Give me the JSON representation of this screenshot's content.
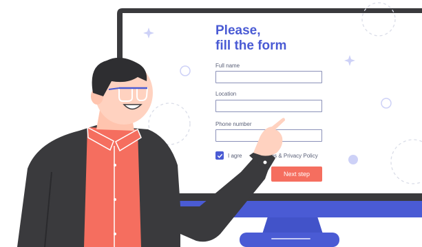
{
  "form": {
    "title_line1": "Please,",
    "title_line2": "fill the form",
    "fields": [
      {
        "label": "Full name",
        "value": ""
      },
      {
        "label": "Location",
        "value": ""
      },
      {
        "label": "Phone number",
        "value": ""
      }
    ],
    "agree_visible_prefix": "I agre",
    "agree_visible_suffix": "ms & Privacy Policy",
    "agree_checked": true,
    "next_button_label": "Next step"
  },
  "colors": {
    "accent": "#4a5bd4",
    "button": "#f56e5f",
    "monitor_frame": "#3a3a3d",
    "monitor_stand": "#4a5bd4",
    "jacket": "#3a3a3d",
    "shirt": "#f56e5f",
    "skin": "#ffd2c0"
  }
}
